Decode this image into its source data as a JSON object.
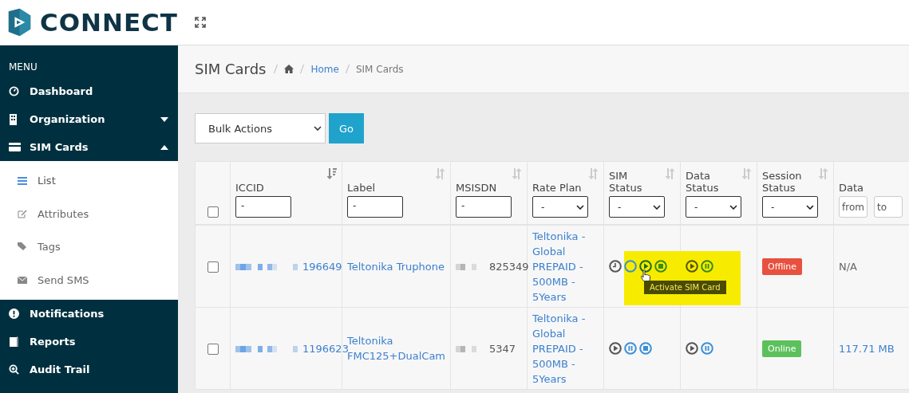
{
  "brand": {
    "name": "CONNECT"
  },
  "sidebar": {
    "heading": "MENU",
    "items": [
      {
        "label": "Dashboard"
      },
      {
        "label": "Organization",
        "expanded": false
      },
      {
        "label": "SIM Cards",
        "expanded": true,
        "children": [
          {
            "label": "List",
            "selected": true
          },
          {
            "label": "Attributes",
            "selected": false
          },
          {
            "label": "Tags",
            "selected": false
          },
          {
            "label": "Send SMS",
            "selected": false
          }
        ]
      },
      {
        "label": "Notifications"
      },
      {
        "label": "Reports"
      },
      {
        "label": "Audit Trail"
      }
    ]
  },
  "page": {
    "title": "SIM Cards",
    "breadcrumb": [
      "Home",
      "SIM Cards"
    ]
  },
  "bulk": {
    "select": "Bulk Actions",
    "button": "Go"
  },
  "table": {
    "select_all_checked": false,
    "columns": [
      {
        "label": "ICCID",
        "kind": "input",
        "value": "-",
        "sorted": true
      },
      {
        "label": "Label",
        "kind": "input",
        "value": "-",
        "sorted": false
      },
      {
        "label": "MSISDN",
        "kind": "input",
        "value": "-",
        "sorted": false
      },
      {
        "label": "Rate Plan",
        "kind": "dropdown",
        "value": "-",
        "sorted": false
      },
      {
        "label": "SIM Status",
        "kind": "dropdown",
        "value": "-",
        "sorted": false
      },
      {
        "label": "Data Status",
        "kind": "dropdown",
        "value": "-",
        "sorted": false
      },
      {
        "label": "Session Status",
        "kind": "dropdown",
        "value": "-",
        "sorted": false
      },
      {
        "label": "Data",
        "kind": "range",
        "fields": [
          {
            "placeholder": "from"
          },
          {
            "placeholder": "to"
          }
        ]
      }
    ],
    "rows": [
      {
        "checked": false,
        "iccid": "196649",
        "label": "Teltonika Truphone",
        "msisdn": "825349",
        "rate_plan": "Teltonika - Global PREPAID - 500MB - 5Years",
        "sim_actions": [
          {
            "kind": "clock",
            "color": "#555555"
          },
          {
            "kind": "ring",
            "color": "#3a8fd8"
          },
          {
            "kind": "play",
            "color": "#1d6b1d"
          },
          {
            "kind": "stop",
            "color": "#3a8a1a"
          }
        ],
        "data_actions": [
          {
            "kind": "play",
            "color": "#555500"
          },
          {
            "kind": "pause",
            "color": "#3a8a1a"
          }
        ],
        "session": {
          "text": "Offline",
          "kind": "offline"
        },
        "data": {
          "text": "N/A",
          "kind": "plain"
        },
        "tooltip": "Activate SIM Card"
      },
      {
        "checked": false,
        "iccid": "1196623",
        "label": "Teltonika FMC125+DualCam",
        "msisdn": "5347",
        "rate_plan": "Teltonika - Global PREPAID - 500MB - 5Years",
        "sim_actions": [
          {
            "kind": "play",
            "color": "#555555"
          },
          {
            "kind": "pause",
            "color": "#3a8fd8"
          },
          {
            "kind": "stop",
            "color": "#3a8fd8"
          }
        ],
        "data_actions": [
          {
            "kind": "play",
            "color": "#555555"
          },
          {
            "kind": "pause",
            "color": "#3a8fd8"
          }
        ],
        "session": {
          "text": "Online",
          "kind": "online"
        },
        "data": {
          "text": "117.71 MB",
          "kind": "link"
        }
      }
    ]
  }
}
